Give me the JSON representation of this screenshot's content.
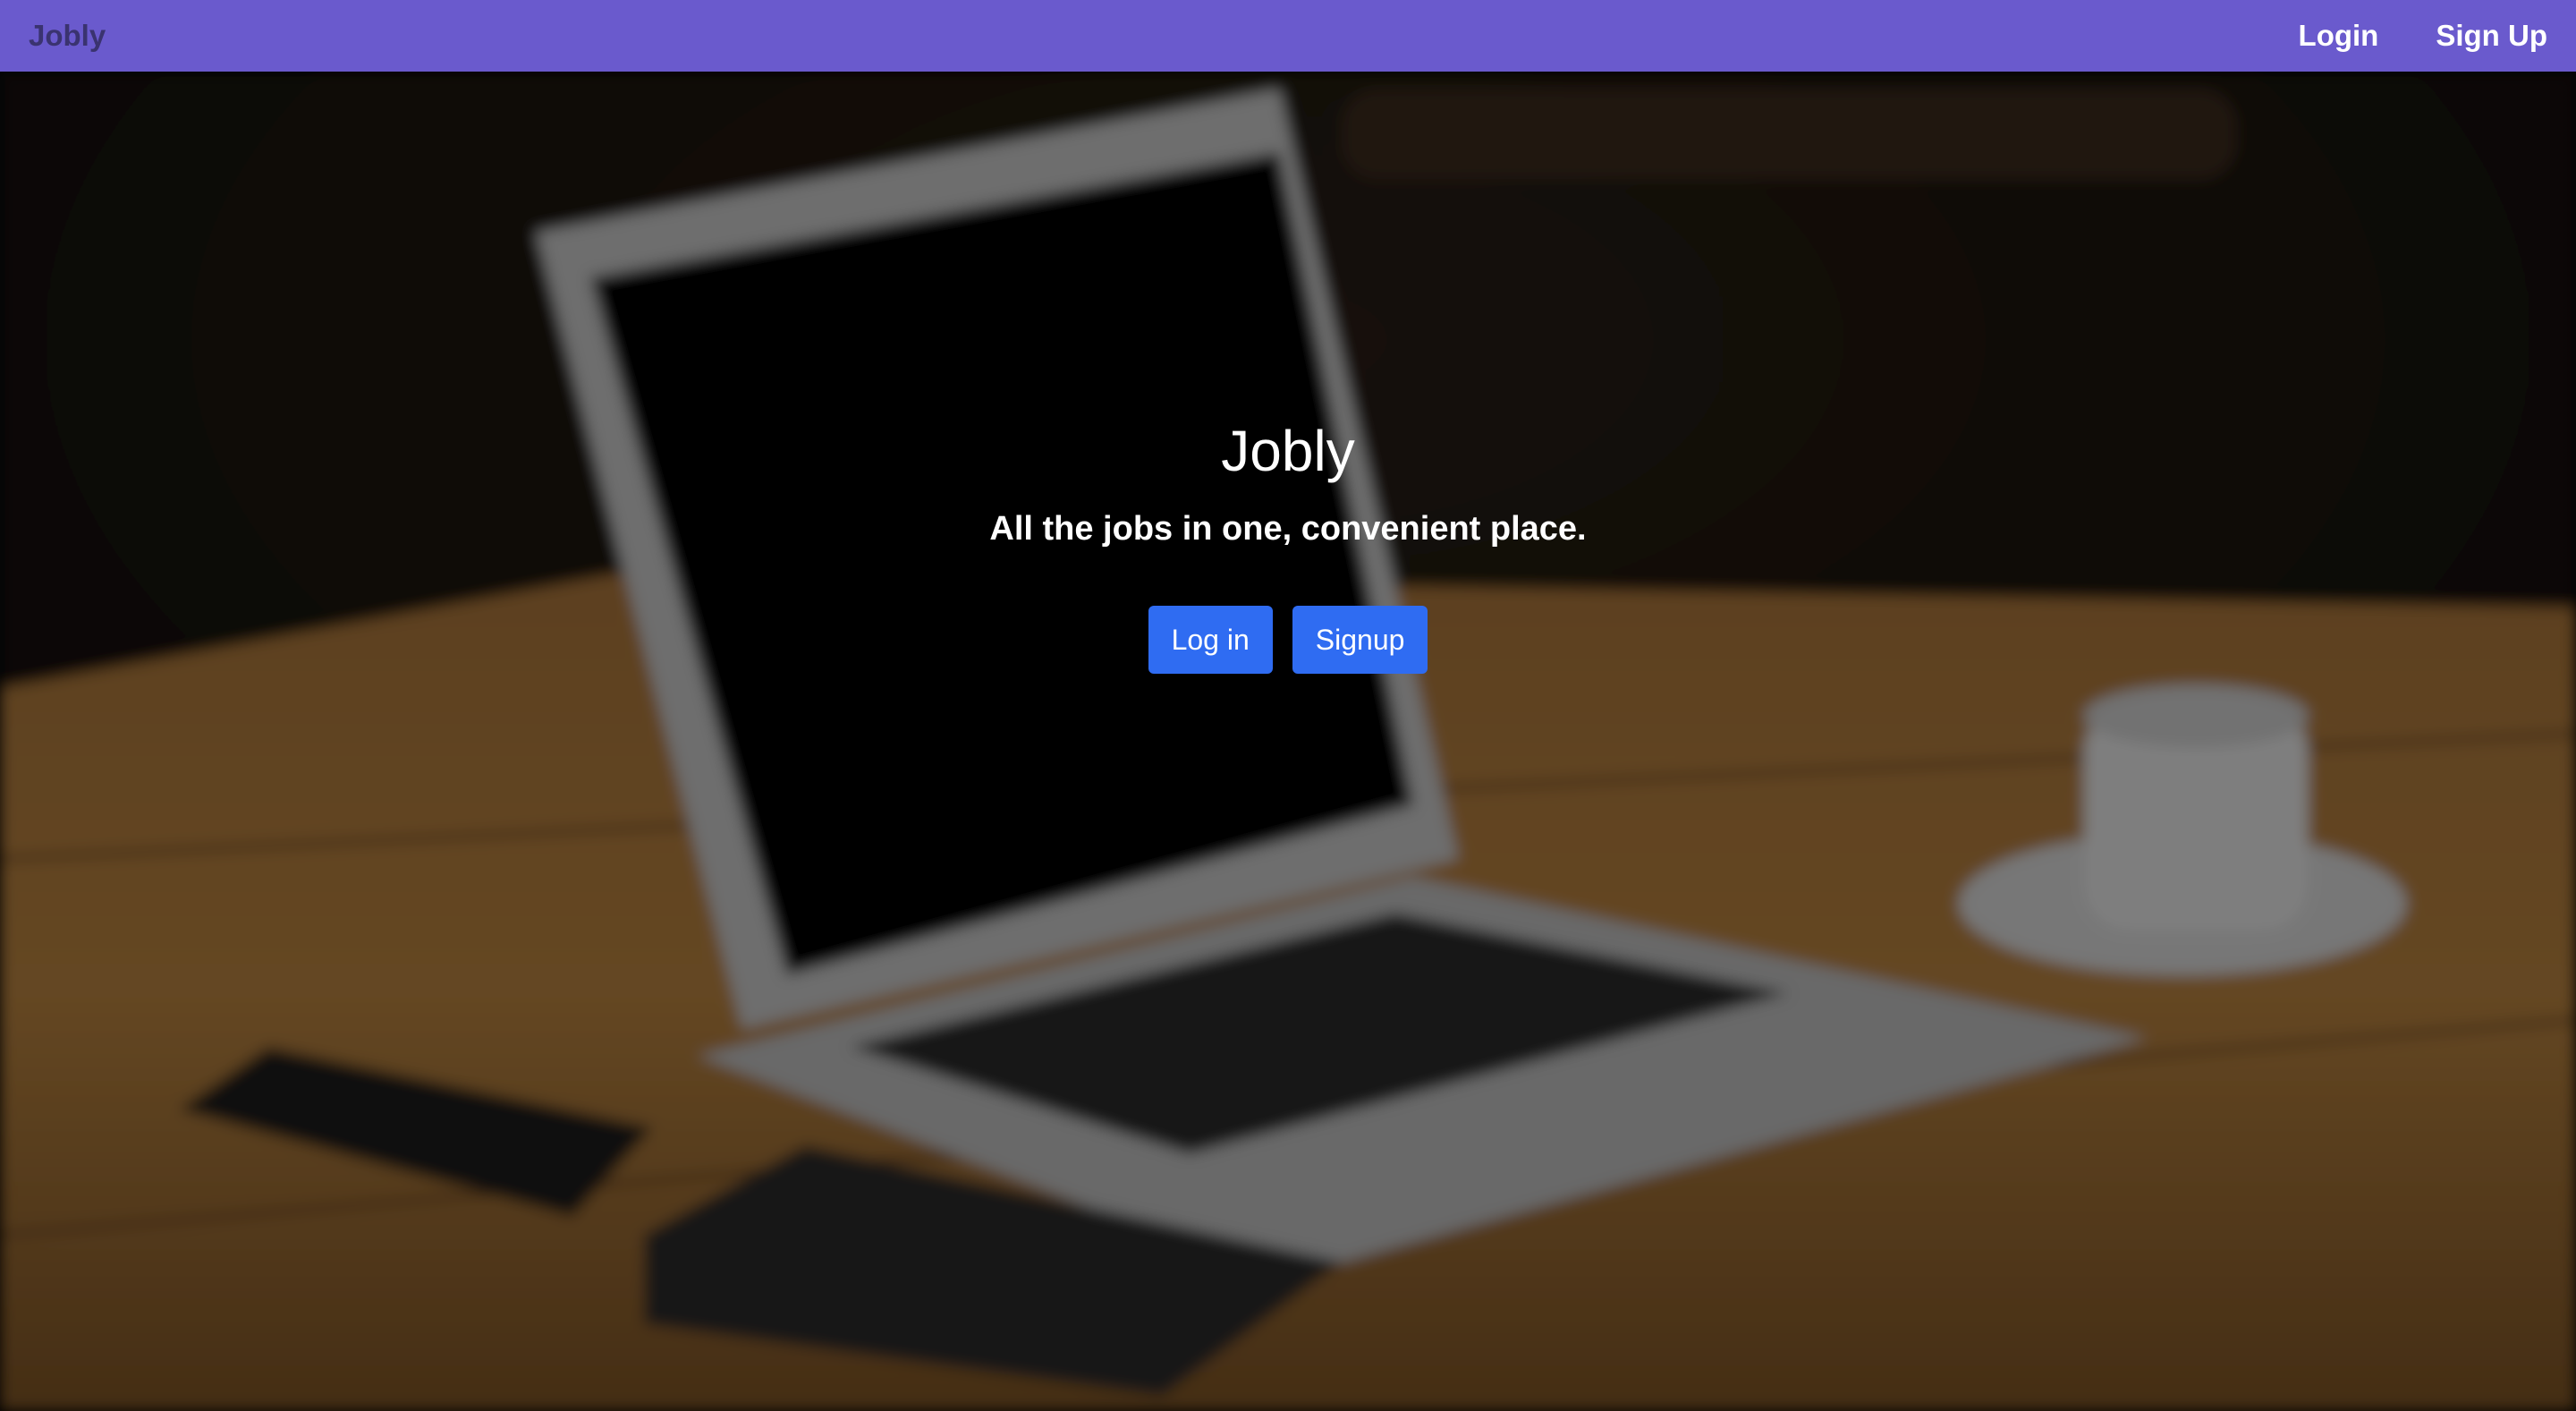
{
  "navbar": {
    "brand": "Jobly",
    "links": {
      "login": "Login",
      "signup": "Sign Up"
    },
    "background_color": "#6a5acd"
  },
  "hero": {
    "title": "Jobly",
    "subtitle": "All the jobs in one, convenient place.",
    "buttons": {
      "login": "Log in",
      "signup": "Signup"
    },
    "button_color": "#2f6cf2",
    "background_image": "blurred photo of a laptop on a wooden desk with a phone, notebook, pen and coffee cup"
  }
}
